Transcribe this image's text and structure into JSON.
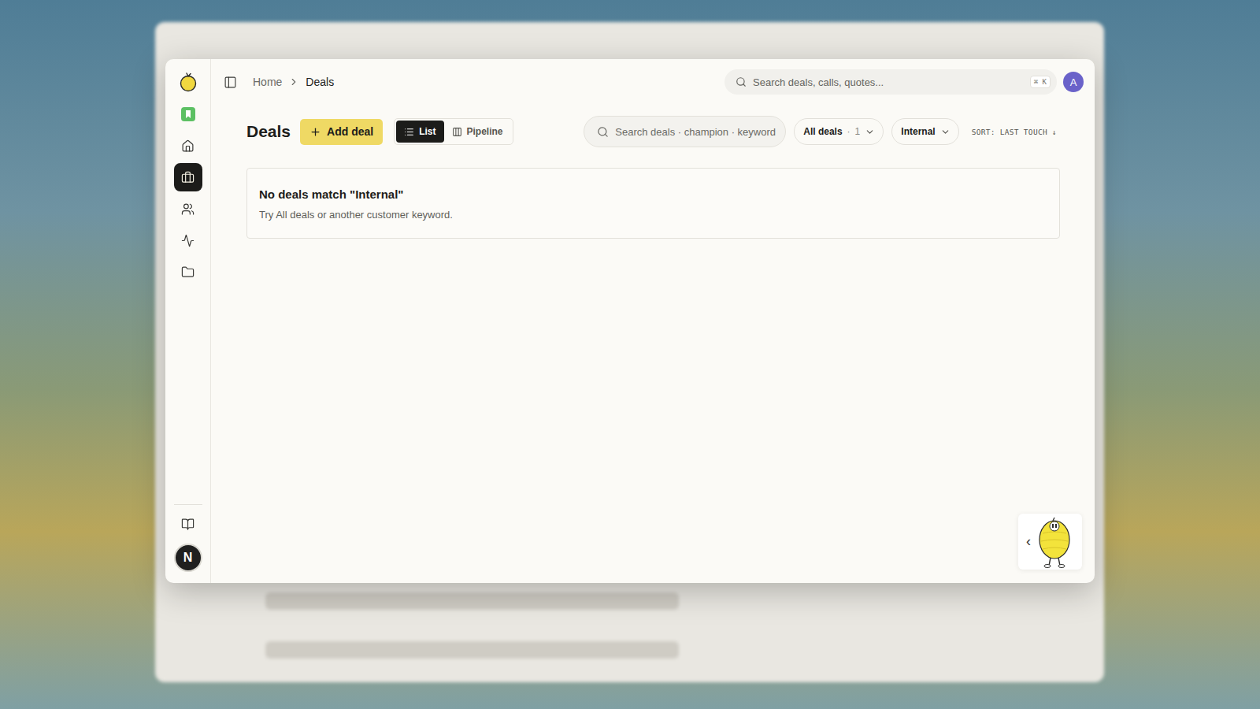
{
  "header": {
    "breadcrumb": [
      "Home",
      "Deals"
    ],
    "breadcrumb_separator": "›",
    "search_placeholder": "Search deals, calls, quotes...",
    "shortcut": "⌘ K",
    "avatar": "A"
  },
  "rail": {
    "nav": [
      {
        "selected": false
      },
      {
        "selected": true
      },
      {
        "selected": false
      },
      {
        "selected": false
      },
      {
        "selected": false
      }
    ],
    "user_avatar": "N"
  },
  "page": {
    "title": "Deals",
    "add_button": "Add deal",
    "views": [
      {
        "label": "List",
        "selected": true
      },
      {
        "label": "Pipeline",
        "selected": false
      }
    ],
    "search_placeholder": "Search deals · champion · keyword",
    "filters": [
      {
        "label": "All deals",
        "separator": "·",
        "count": "1"
      },
      {
        "label": "Internal",
        "separator": "",
        "count": ""
      }
    ],
    "sort": "SORT: LAST TOUCH ↓"
  },
  "empty_state": {
    "title": "No deals match \"Internal\"",
    "hint": "Try All deals or another customer keyword."
  },
  "assistant": {
    "toggle": "‹"
  }
}
